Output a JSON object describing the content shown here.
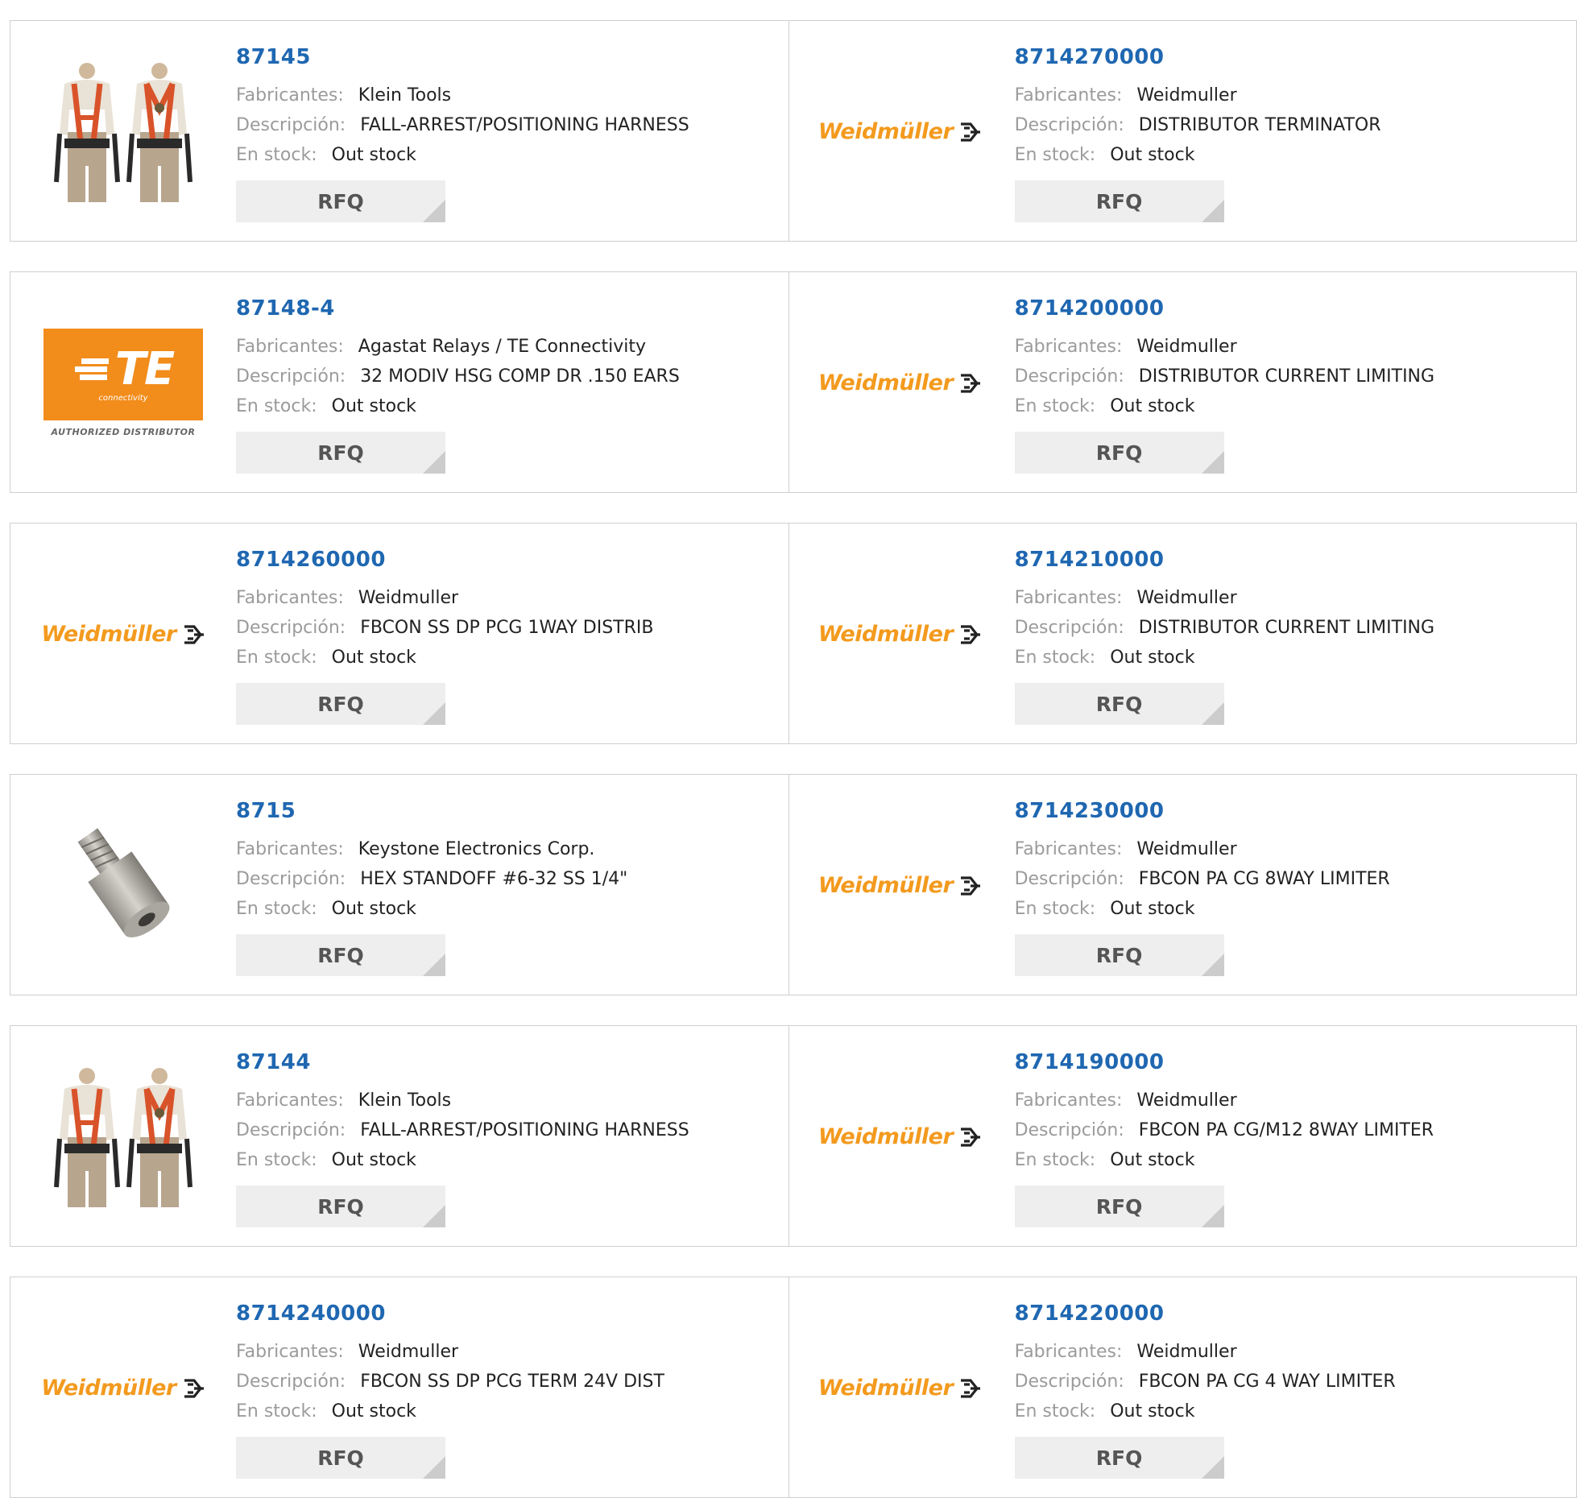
{
  "labels": {
    "manufacturer": "Fabricantes:",
    "description": "Descripción:",
    "stock": "En stock:",
    "rfq": "RFQ"
  },
  "logos": {
    "weidmuller": "Weidmüller",
    "te_mark": "TE",
    "te_sub": "connectivity",
    "te_distributor": "AUTHORIZED DISTRIBUTOR"
  },
  "colors": {
    "part_number": "#1f67b1",
    "weidmuller_orange": "#f39a1e",
    "te_orange": "#f28c1b"
  },
  "products": [
    {
      "part": "87145",
      "manufacturer": "Klein Tools",
      "description": "FALL-ARREST/POSITIONING HARNESS",
      "stock": "Out stock",
      "image": "harness-image"
    },
    {
      "part": "8714270000",
      "manufacturer": "Weidmuller",
      "description": "DISTRIBUTOR TERMINATOR",
      "stock": "Out stock",
      "image": "weidmuller-logo"
    },
    {
      "part": "87148-4",
      "manufacturer": "Agastat Relays / TE Connectivity",
      "description": "32 MODIV HSG COMP DR .150 EARS",
      "stock": "Out stock",
      "image": "te-logo"
    },
    {
      "part": "8714200000",
      "manufacturer": "Weidmuller",
      "description": "DISTRIBUTOR CURRENT LIMITING",
      "stock": "Out stock",
      "image": "weidmuller-logo"
    },
    {
      "part": "8714260000",
      "manufacturer": "Weidmuller",
      "description": "FBCON SS DP PCG 1WAY DISTRIB",
      "stock": "Out stock",
      "image": "weidmuller-logo"
    },
    {
      "part": "8714210000",
      "manufacturer": "Weidmuller",
      "description": "DISTRIBUTOR CURRENT LIMITING",
      "stock": "Out stock",
      "image": "weidmuller-logo"
    },
    {
      "part": "8715",
      "manufacturer": "Keystone Electronics Corp.",
      "description": "HEX STANDOFF #6-32 SS 1/4\"",
      "stock": "Out stock",
      "image": "standoff-image"
    },
    {
      "part": "8714230000",
      "manufacturer": "Weidmuller",
      "description": "FBCON PA CG 8WAY LIMITER",
      "stock": "Out stock",
      "image": "weidmuller-logo"
    },
    {
      "part": "87144",
      "manufacturer": "Klein Tools",
      "description": "FALL-ARREST/POSITIONING HARNESS",
      "stock": "Out stock",
      "image": "harness-image"
    },
    {
      "part": "8714190000",
      "manufacturer": "Weidmuller",
      "description": "FBCON PA CG/M12 8WAY LIMITER",
      "stock": "Out stock",
      "image": "weidmuller-logo"
    },
    {
      "part": "8714240000",
      "manufacturer": "Weidmuller",
      "description": "FBCON SS DP PCG TERM 24V DIST",
      "stock": "Out stock",
      "image": "weidmuller-logo"
    },
    {
      "part": "8714220000",
      "manufacturer": "Weidmuller",
      "description": "FBCON PA CG 4 WAY LIMITER",
      "stock": "Out stock",
      "image": "weidmuller-logo"
    }
  ]
}
